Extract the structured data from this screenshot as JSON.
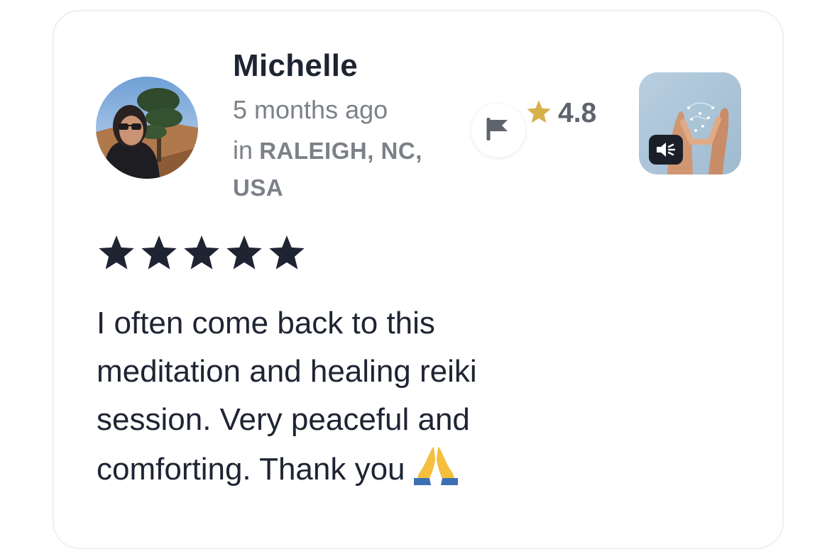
{
  "review": {
    "reviewer_name": "Michelle",
    "time_ago": "5 months ago",
    "location_prefix": "in",
    "location_line1": "RALEIGH, NC,",
    "location_line2": "USA",
    "track_rating": "4.8",
    "user_stars": 5,
    "text": "I often come back to this meditation and healing reiki session. Very peaceful and comforting. Thank you"
  },
  "icons": {
    "avatar": "reviewer-avatar",
    "flag": "flag-icon",
    "rating_star": "star-icon",
    "thumbnail": "track-thumbnail",
    "audio": "speaker-icon",
    "emoji": "folded-hands-emoji"
  },
  "colors": {
    "star_gold": "#D8B04C",
    "star_dark": "#1F2433",
    "text_dark": "#1F2433",
    "text_muted": "#7C8088"
  }
}
